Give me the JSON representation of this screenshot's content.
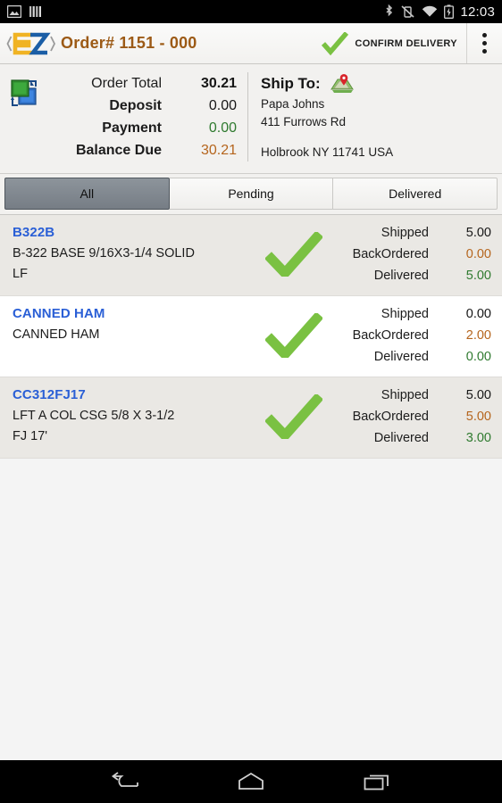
{
  "statusbar": {
    "left_icons": [
      "screenshot-icon",
      "bars-icon"
    ],
    "right_icons": [
      "bluetooth-icon",
      "vibrate-muted-icon",
      "wifi-icon",
      "battery-charging-icon"
    ],
    "clock": "12:03"
  },
  "appbar": {
    "logo_name": "s2-logo",
    "title": "Order# 1151 - 000",
    "confirm_label": "CONFIRM DELIVERY",
    "overflow_name": "overflow-menu-icon",
    "title_color": "#9c5a16"
  },
  "summary": {
    "swap_icon": "swap-orders-icon",
    "rows": [
      {
        "label": "Order Total",
        "value": "30.21",
        "label_bold": false,
        "value_color": "dark",
        "value_bold": true
      },
      {
        "label": "Deposit",
        "value": "0.00",
        "label_bold": true,
        "value_color": "dark",
        "value_bold": false
      },
      {
        "label": "Payment",
        "value": "0.00",
        "label_bold": true,
        "value_color": "green",
        "value_bold": false
      },
      {
        "label": "Balance Due",
        "value": "30.21",
        "label_bold": true,
        "value_color": "orange",
        "value_bold": false
      }
    ],
    "shipto": {
      "label": "Ship To:",
      "map_icon": "map-pin-icon",
      "name": "Papa Johns",
      "street": "411 Furrows Rd",
      "city_state_zip": "Holbrook NY 11741 USA"
    }
  },
  "tabs": [
    {
      "label": "All",
      "active": true
    },
    {
      "label": "Pending",
      "active": false
    },
    {
      "label": "Delivered",
      "active": false
    }
  ],
  "list": {
    "quantity_labels": {
      "shipped": "Shipped",
      "backordered": "BackOrdered",
      "delivered": "Delivered"
    },
    "items": [
      {
        "sku": "B322B",
        "desc_line1": "B-322 BASE 9/16X3-1/4 SOLID",
        "desc_line2": "LF",
        "check_icon": "green-check-icon",
        "shipped": "5.00",
        "backordered": "0.00",
        "delivered": "5.00",
        "row_style": "alt"
      },
      {
        "sku": "CANNED HAM",
        "desc_line1": "CANNED HAM",
        "desc_line2": "",
        "check_icon": "green-check-icon",
        "shipped": "0.00",
        "backordered": "2.00",
        "delivered": "0.00",
        "row_style": "plain"
      },
      {
        "sku": "CC312FJ17",
        "desc_line1": "LFT A COL CSG 5/8 X 3-1/2",
        "desc_line2": "FJ 17'",
        "check_icon": "green-check-icon",
        "shipped": "5.00",
        "backordered": "5.00",
        "delivered": "3.00",
        "row_style": "alt"
      }
    ]
  },
  "navbar": {
    "back": "back-icon",
    "home": "home-icon",
    "recents": "recents-icon"
  },
  "colors": {
    "sku_blue": "#2a5fd6",
    "title_orange": "#9c5a16",
    "value_green": "#2f7a2f",
    "value_orange": "#b5651d",
    "check_green": "#7ac142"
  }
}
